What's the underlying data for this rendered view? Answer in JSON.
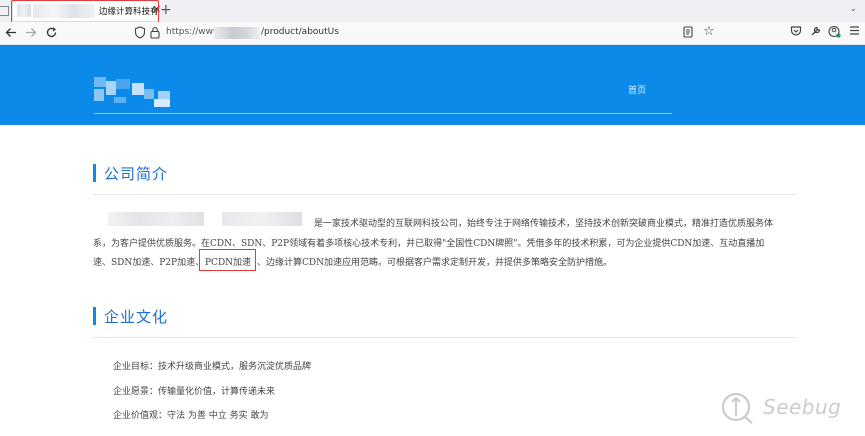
{
  "browser": {
    "tab_title": "边缘计算科技有",
    "tab_close": "✕",
    "new_tab": "+",
    "url_scheme": "https://www",
    "url_path": "/product/aboutUs",
    "accent_highlight": "#e23b3b"
  },
  "site": {
    "nav_home": "首页",
    "banner_color": "#0b8aea"
  },
  "about": {
    "title": "公司简介",
    "line1": "是一家技术驱动型的互联网科技公司，始终专注于网络传输技术，坚持技术创新突破商业模式，精准打造优质服务体",
    "line2": "系，为客户提供优质服务。在CDN、SDN、P2P领域有着多项核心技术专利，并已取得\"全国性CDN牌照\"。凭借多年的技术积累，可为企业提供CDN加速、互动直播加",
    "line3_a": "速、SDN加速、P2P加速、",
    "line3_hl": "PCDN加速",
    "line3_b": "、边缘计算CDN加速应用范畴。可根据客户需求定制开发，并提供多策略安全防护措施。"
  },
  "culture": {
    "title": "企业文化",
    "goal": "企业目标：技术升级商业模式，服务沉淀优质品牌",
    "vision": "企业愿景：传输量化价值，计算传递未来",
    "values": "企业价值观：守法 为善 中立 务实 敢为"
  },
  "watermark": {
    "text": "Seebug"
  },
  "icons": [
    "back-arrow-icon",
    "forward-arrow-icon",
    "reload-icon",
    "shield-icon",
    "lock-icon",
    "reader-view-icon",
    "bookmark-star-icon",
    "pocket-icon",
    "extensions-icon",
    "account-icon",
    "menu-icon",
    "close-icon",
    "new-tab-icon"
  ]
}
